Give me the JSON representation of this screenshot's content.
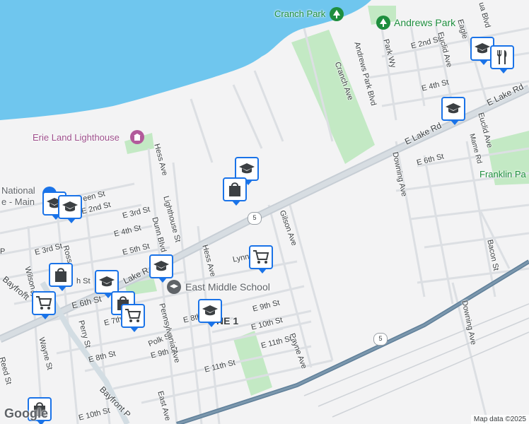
{
  "map": {
    "water_color": "#6fc6ee",
    "park_color": "#c3e9c4",
    "land_color": "#f3f3f4",
    "street_color": "#dadce0",
    "road_color": "#bfc8d0",
    "highway_color": "#5f7f99"
  },
  "places": {
    "cranch_park": "Cranch Park",
    "andrews_park": "Andrews Park",
    "erie_land_lighthouse": "Erie Land Lighthouse",
    "east_middle_school": "East Middle School",
    "franklin_park": "Franklin Pa",
    "national_fragment": "National",
    "main_fragment": "e - Main",
    "zone_fragment": "NE 1"
  },
  "streets": {
    "e_lake_rd": "E Lake Rd",
    "e_lake_rd_west": "Lake R",
    "hess_ave_north": "Hess Ave",
    "hess_ave_south": "Hess Ave",
    "lighthouse_st": "Lighthouse St",
    "dunn_blvd": "Dunn Blvd",
    "gilson_ave": "Gilson Ave",
    "lynn": "Lynn",
    "cranch_ave": "Cranch Ave",
    "andrews_park_blvd": "Andrews Park Blvd",
    "park_wy": "Park Wy",
    "e_2nd_st_east": "E 2nd St",
    "euclid_ave_north": "Euclid Ave",
    "eagle": "Eagle",
    "ua_blvd": "ua Blvd",
    "e_4th_st_east": "E 4th St",
    "euclid_ave": "Euclid Ave",
    "mame_rd": "Mame Rd",
    "e_6th_st_east": "E 6th St",
    "downing_ave_north": "Downing Ave",
    "downing_ave_south": "Downing Ave",
    "bacon_st": "Bacon St",
    "payne_ave": "Payne Ave",
    "e_9th_st": "E 9th St",
    "e_10th_st": "E 10th St",
    "e_11th_st_east": "E 11th St",
    "e_11th_st": "E 11th St",
    "e_8th_st": "E 8th",
    "e_9th_st_west": "E 9th St",
    "polk_st": "Polk St",
    "pennsylvania_ave": "Pennsylvania Ave",
    "east_ave": "East Ave",
    "e_8th_st_west": "E 8th St",
    "e_10th_st_west": "E 10th St",
    "bayfront_p": "Bayfront P",
    "reed_st": "Reed St",
    "wayne_st": "Wayne St",
    "perry_st": "Perry St",
    "e_6th_st": "E 6th St",
    "e_7th": "E 7th",
    "e_5th_st": "E 5th St",
    "e_4th_st": "E 4th St",
    "e_3rd_st": "E 3rd St",
    "e_3rd_st_west": "E 3rd St",
    "e_2nd_st": "E 2nd St",
    "een_st": "een St",
    "ross": "Ross",
    "wilson": "Wilson",
    "bayfront": "Bayfront",
    "sst": "s St",
    "sh_st": "h St",
    "ps": "P"
  },
  "shields": {
    "route_5_a": "5",
    "route_5_b": "5"
  },
  "pins": [
    {
      "name": "school-pin-1",
      "icon": "graduation-cap-icon"
    },
    {
      "name": "restaurant-pin",
      "icon": "fork-knife-icon"
    },
    {
      "name": "school-pin-2",
      "icon": "graduation-cap-icon"
    },
    {
      "name": "school-pin-3",
      "icon": "graduation-cap-icon"
    },
    {
      "name": "shopping-pin-1",
      "icon": "shopping-bag-icon"
    },
    {
      "name": "school-pin-4",
      "icon": "graduation-cap-icon"
    },
    {
      "name": "school-pin-5",
      "icon": "graduation-cap-icon"
    },
    {
      "name": "cart-pin-1",
      "icon": "shopping-cart-icon"
    },
    {
      "name": "school-pin-6",
      "icon": "graduation-cap-icon"
    },
    {
      "name": "shopping-pin-2",
      "icon": "shopping-bag-icon"
    },
    {
      "name": "school-pin-7",
      "icon": "graduation-cap-icon"
    },
    {
      "name": "cart-pin-2",
      "icon": "shopping-cart-icon"
    },
    {
      "name": "shopping-pin-3",
      "icon": "shopping-bag-icon"
    },
    {
      "name": "cart-pin-3",
      "icon": "shopping-cart-icon"
    },
    {
      "name": "school-pin-8",
      "icon": "graduation-cap-icon"
    },
    {
      "name": "shopping-pin-4",
      "icon": "shopping-bag-icon"
    }
  ],
  "footer": {
    "google_logo": "Google",
    "attribution": "Map data ©2025"
  }
}
